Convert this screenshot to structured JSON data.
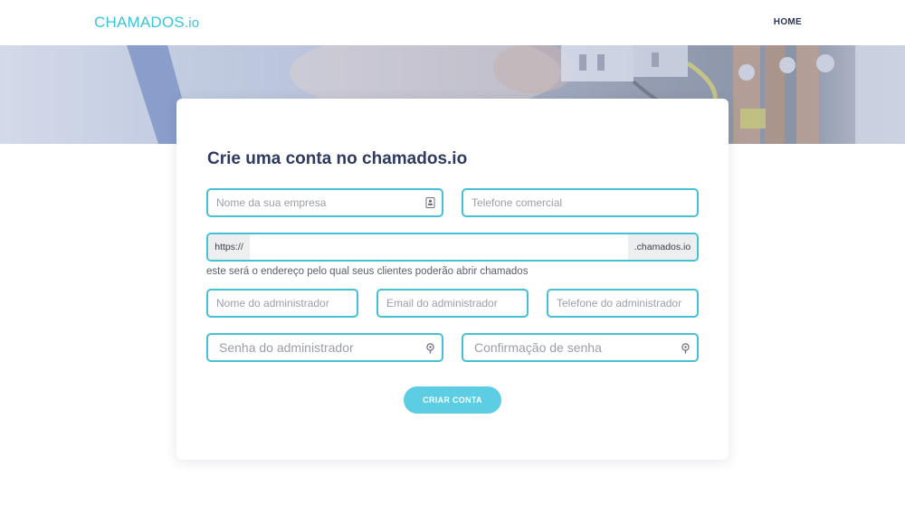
{
  "navbar": {
    "logo_brand": "CHAMADOS",
    "logo_tld": ".io",
    "home_label": "HOME"
  },
  "form": {
    "title": "Crie uma conta no chamados.io",
    "company_name_placeholder": "Nome da sua empresa",
    "business_phone_placeholder": "Telefone comercial",
    "url_prefix": "https://",
    "url_value": "",
    "url_suffix": ".chamados.io",
    "url_help": "este será o endereço pelo qual seus clientes poderão abrir chamados",
    "admin_name_placeholder": "Nome do administrador",
    "admin_email_placeholder": "Email do administrador",
    "admin_phone_placeholder": "Telefone do administrador",
    "admin_password_placeholder": "Senha do administrador",
    "password_confirm_placeholder": "Confirmação de senha",
    "submit_label": "CRIAR CONTA"
  },
  "icons": {
    "company_field_icon": "contact-card-icon",
    "password_field_icon": "key-icon",
    "password_confirm_field_icon": "key-icon"
  },
  "colors": {
    "accent": "#44c1d6",
    "button": "#5ccde2",
    "title": "#2f3a60",
    "nav_text": "#2c3554"
  }
}
